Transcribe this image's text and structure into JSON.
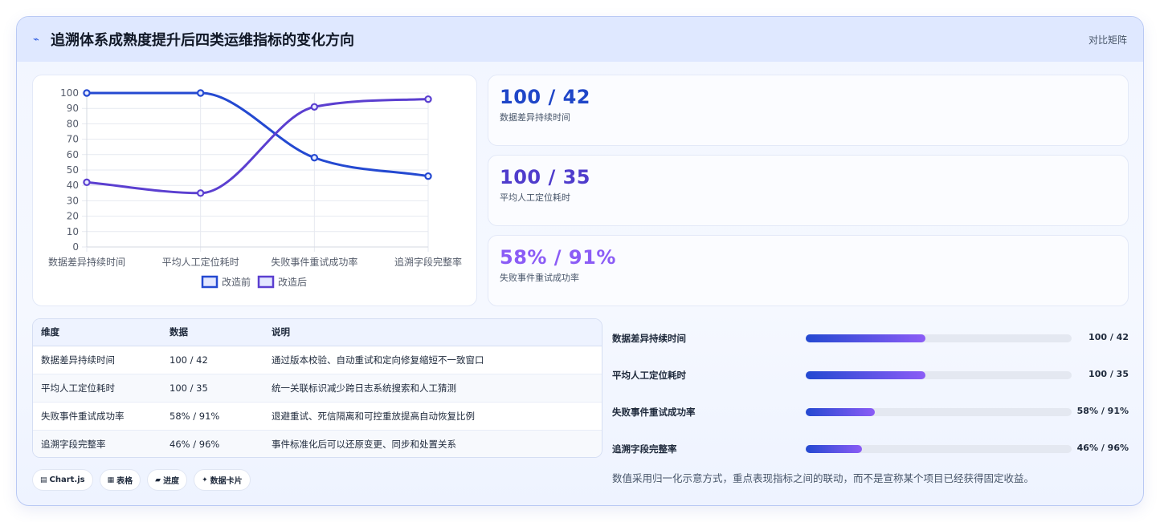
{
  "header": {
    "icon": "bolt-icon",
    "title": "追溯体系成熟度提升后四类运维指标的变化方向",
    "tag": "对比矩阵"
  },
  "chart_data": {
    "type": "line",
    "categories": [
      "数据差异持续时间",
      "平均人工定位耗时",
      "失败事件重试成功率",
      "追溯字段完整率"
    ],
    "series": [
      {
        "name": "改造前",
        "values": [
          100,
          100,
          58,
          46
        ],
        "color": "#2449d1"
      },
      {
        "name": "改造后",
        "values": [
          42,
          35,
          91,
          96
        ],
        "color": "#5b3fd0"
      }
    ],
    "ylim": [
      0,
      100
    ],
    "yticks": [
      "0",
      "10",
      "20",
      "30",
      "40",
      "50",
      "60",
      "70",
      "80",
      "90",
      "100"
    ],
    "legend_position": "bottom",
    "grid": true
  },
  "stats": [
    {
      "value": "100 / 42",
      "label": "数据差异持续时间",
      "color": "#1f46c8"
    },
    {
      "value": "100 / 35",
      "label": "平均人工定位耗时",
      "color": "#4f3ccc"
    },
    {
      "value": "58% / 91%",
      "label": "失败事件重试成功率",
      "color": "#8b5cf6"
    }
  ],
  "table": {
    "headers": [
      "维度",
      "数据",
      "说明"
    ],
    "rows": [
      [
        "数据差异持续时间",
        "100 / 42",
        "通过版本校验、自动重试和定向修复缩短不一致窗口"
      ],
      [
        "平均人工定位耗时",
        "100 / 35",
        "统一关联标识减少跨日志系统搜索和人工猜测"
      ],
      [
        "失败事件重试成功率",
        "58% / 91%",
        "退避重试、死信隔离和可控重放提高自动恢复比例"
      ],
      [
        "追溯字段完整率",
        "46% / 96%",
        "事件标准化后可以还原变更、同步和处置关系"
      ]
    ]
  },
  "chips": [
    {
      "icon": "chart-icon",
      "glyph": "▤",
      "label": "Chart.js"
    },
    {
      "icon": "table-icon",
      "glyph": "▦",
      "label": "表格"
    },
    {
      "icon": "progress-icon",
      "glyph": "▰",
      "label": "进度"
    },
    {
      "icon": "sparkle-icon",
      "glyph": "✦",
      "label": "数据卡片"
    }
  ],
  "progress": [
    {
      "label": "数据差异持续时间",
      "value": "100 / 42",
      "fraction": 0.45
    },
    {
      "label": "平均人工定位耗时",
      "value": "100 / 35",
      "fraction": 0.45
    },
    {
      "label": "失败事件重试成功率",
      "value": "58% / 91%",
      "fraction": 0.26
    },
    {
      "label": "追溯字段完整率",
      "value": "46% / 96%",
      "fraction": 0.21
    }
  ],
  "note": "数值采用归一化示意方式，重点表现指标之间的联动，而不是宣称某个项目已经获得固定收益。"
}
